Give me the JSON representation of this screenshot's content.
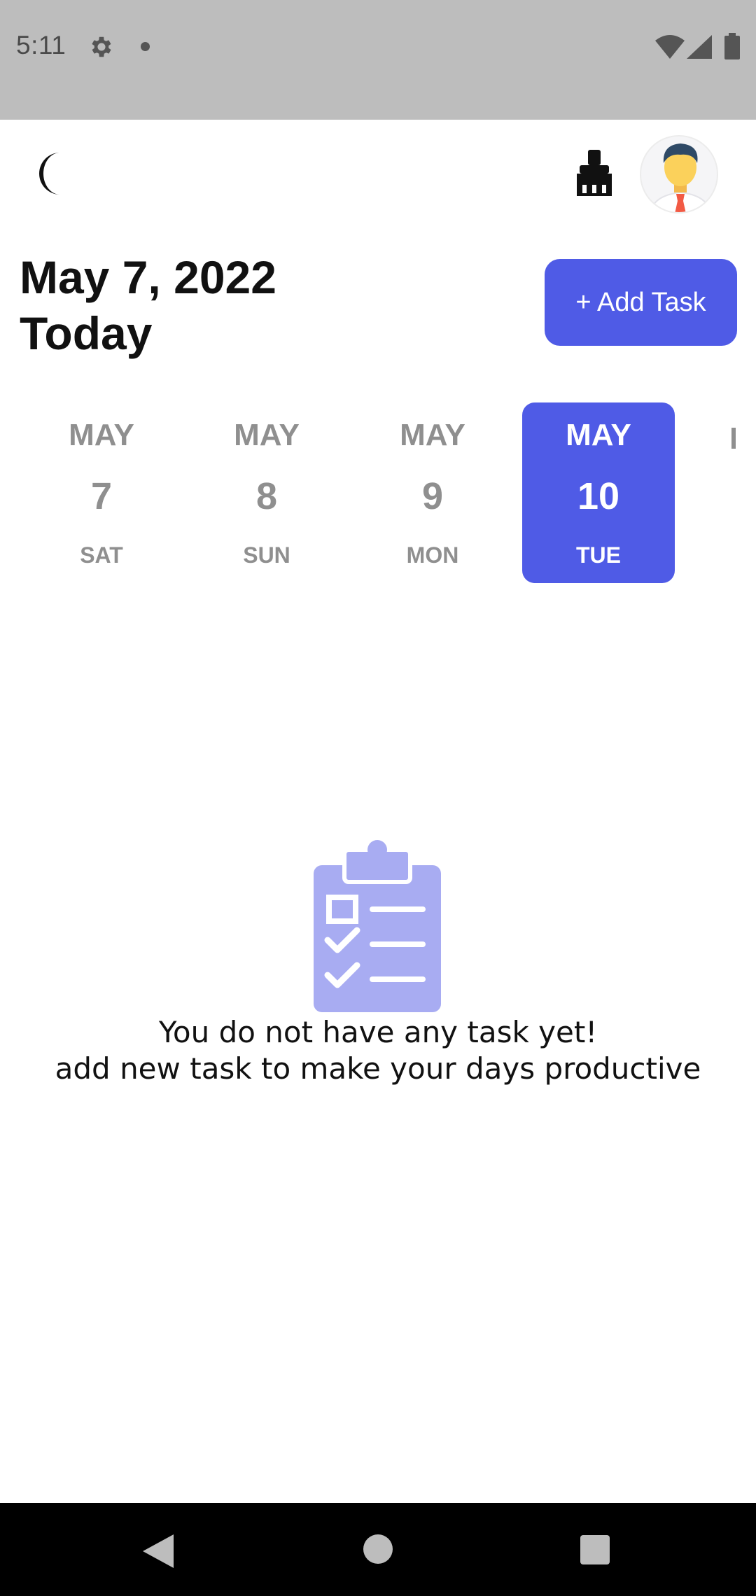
{
  "status_bar": {
    "time": "5:11",
    "icons": [
      "gear-icon",
      "notification-dot",
      "wifi-icon",
      "signal-icon",
      "battery-icon"
    ]
  },
  "header": {
    "theme_icon": "moon-icon",
    "clear_icon": "broom-icon",
    "avatar": "user-avatar"
  },
  "heading": {
    "date": "May 7, 2022",
    "today": "Today"
  },
  "add_task": {
    "label": "+ Add Task"
  },
  "date_strip": {
    "items": [
      {
        "month": "MAY",
        "day": "7",
        "weekday": "SAT",
        "selected": false
      },
      {
        "month": "MAY",
        "day": "8",
        "weekday": "SUN",
        "selected": false
      },
      {
        "month": "MAY",
        "day": "9",
        "weekday": "MON",
        "selected": false
      },
      {
        "month": "MAY",
        "day": "10",
        "weekday": "TUE",
        "selected": true
      }
    ]
  },
  "empty_state": {
    "icon": "clipboard-checklist-icon",
    "line1": "You do not have any task yet!",
    "line2": "add new task to make your days productive"
  },
  "colors": {
    "accent": "#4f5be6",
    "accent_light": "#a8acf2",
    "muted_text": "#8f8f8f"
  }
}
